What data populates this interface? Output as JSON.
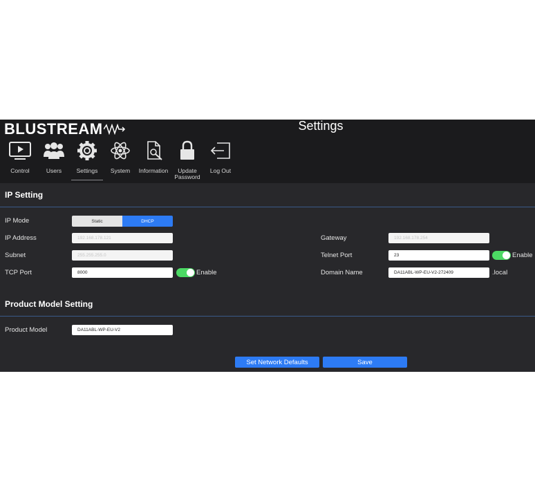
{
  "header": {
    "logo_text": "BLUSTREAM",
    "page_title": "Settings"
  },
  "nav": [
    {
      "label": "Control",
      "icon": "monitor-play-icon"
    },
    {
      "label": "Users",
      "icon": "users-icon"
    },
    {
      "label": "Settings",
      "icon": "gear-icon",
      "active": true
    },
    {
      "label": "System",
      "icon": "atom-icon"
    },
    {
      "label": "Information",
      "icon": "document-search-icon"
    },
    {
      "label_line1": "Update",
      "label_line2": "Password",
      "icon": "lock-icon"
    },
    {
      "label": "Log Out",
      "icon": "logout-icon"
    }
  ],
  "ip_setting": {
    "title": "IP Setting",
    "ip_mode_label": "IP Mode",
    "ip_mode_options": [
      "Static",
      "DHCP"
    ],
    "ip_mode_selected": "DHCP",
    "ip_address_label": "IP Address",
    "ip_address_placeholder": "192.168.178.121",
    "subnet_label": "Subnet",
    "subnet_placeholder": "255.255.255.0",
    "tcp_port_label": "TCP Port",
    "tcp_port_value": "8000",
    "tcp_enable_label": "Enable",
    "gateway_label": "Gateway",
    "gateway_placeholder": "192.168.178.254",
    "telnet_port_label": "Telnet Port",
    "telnet_port_value": "23",
    "telnet_enable_label": "Enable",
    "domain_name_label": "Domain Name",
    "domain_name_value": "DA11ABL-WP-EU-V2-272409",
    "domain_suffix": ".local"
  },
  "product_model_setting": {
    "title": "Product Model Setting",
    "product_model_label": "Product Model",
    "product_model_value": "DA11ABL-WP-EU-V2"
  },
  "actions": {
    "set_defaults_label": "Set Network Defaults",
    "save_label": "Save"
  },
  "colors": {
    "accent": "#2d7bf4",
    "toggle_on": "#4cd964",
    "background": "#28282b",
    "header_background": "#1b1b1d"
  }
}
